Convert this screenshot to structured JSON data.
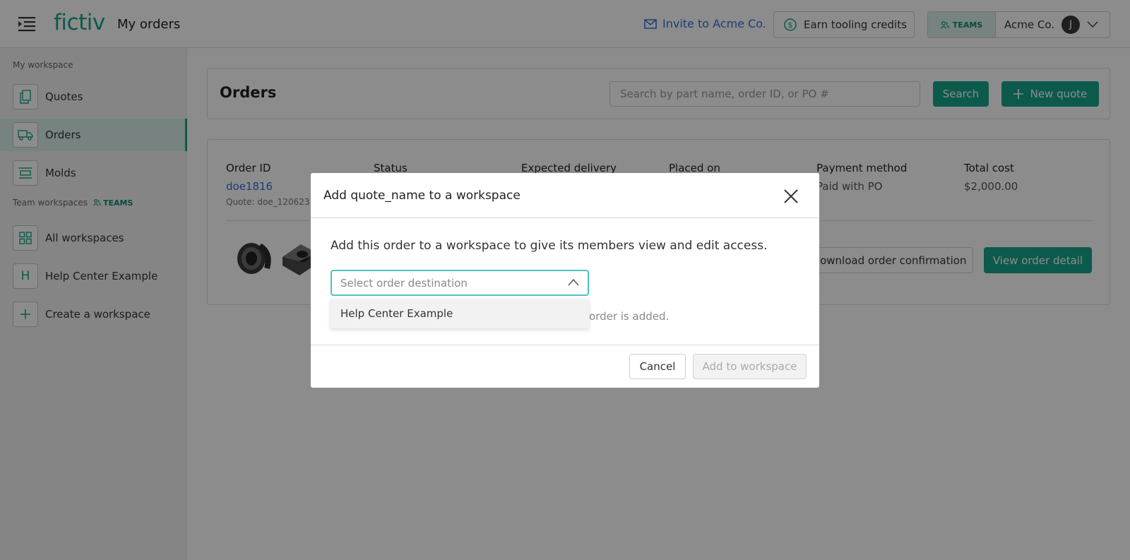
{
  "header": {
    "logo": "fictiv",
    "page_name": "My orders",
    "invite_label": "Invite to Acme Co.",
    "earn_label": "Earn tooling credits",
    "teams_badge": "TEAMS",
    "account_name": "Acme Co.",
    "avatar_initial": "J"
  },
  "sidebar": {
    "my_workspace_label": "My workspace",
    "my_items": [
      {
        "label": "Quotes",
        "icon": "document-copy-icon"
      },
      {
        "label": "Orders",
        "icon": "truck-icon",
        "active": true
      },
      {
        "label": "Molds",
        "icon": "mold-icon"
      }
    ],
    "team_workspaces_label": "Team workspaces",
    "teams_badge": "TEAMS",
    "team_items": [
      {
        "label": "All workspaces",
        "icon": "grid-icon"
      },
      {
        "label": "Help Center Example",
        "icon_letter": "H"
      },
      {
        "label": "Create a workspace",
        "icon": "plus-icon"
      }
    ]
  },
  "orders": {
    "title": "Orders",
    "search_placeholder": "Search by part name, order ID, or PO #",
    "search_label": "Search",
    "new_quote_label": "New quote"
  },
  "order_card": {
    "columns": [
      {
        "header": "Order ID",
        "value": "doe1816",
        "sub": "Quote: doe_120623"
      },
      {
        "header": "Status",
        "value": ""
      },
      {
        "header": "Expected delivery",
        "value": ""
      },
      {
        "header": "Placed on",
        "value": ""
      },
      {
        "header": "Payment method",
        "value": "Paid with PO"
      },
      {
        "header": "Total cost",
        "value": "$2,000.00"
      }
    ],
    "download_label": "Download order confirmation",
    "view_label": "View order detail"
  },
  "modal": {
    "title": "Add quote_name to a workspace",
    "description": "Add this order to a workspace to give its members view and edit access.",
    "select_placeholder": "Select order destination",
    "option": "Help Center Example",
    "hint": "order is added.",
    "cancel_label": "Cancel",
    "add_label": "Add to workspace"
  },
  "colors": {
    "accent": "#17a589",
    "link": "#2f6fe0",
    "select_border": "#4fc3c3"
  }
}
